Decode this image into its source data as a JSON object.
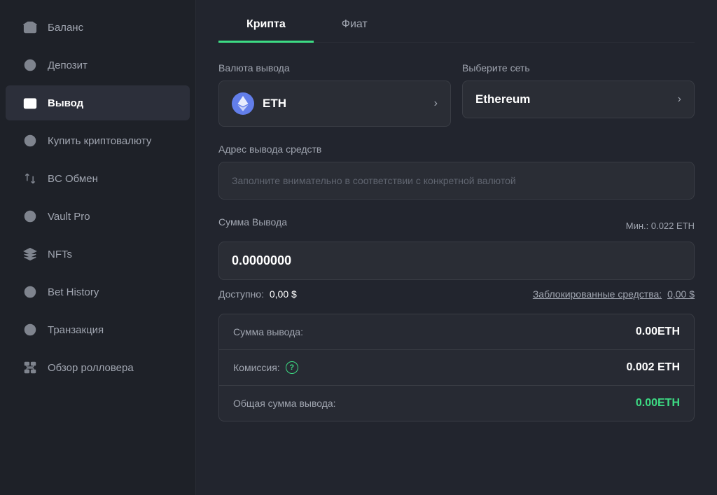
{
  "sidebar": {
    "items": [
      {
        "id": "balance",
        "label": "Баланс",
        "icon": "wallet"
      },
      {
        "id": "deposit",
        "label": "Депозит",
        "icon": "deposit"
      },
      {
        "id": "withdrawal",
        "label": "Вывод",
        "icon": "withdrawal",
        "active": true
      },
      {
        "id": "buy-crypto",
        "label": "Купить криптовалюту",
        "icon": "buy-crypto"
      },
      {
        "id": "bc-exchange",
        "label": "BC Обмен",
        "icon": "exchange"
      },
      {
        "id": "vault-pro",
        "label": "Vault Pro",
        "icon": "vault"
      },
      {
        "id": "nfts",
        "label": "NFTs",
        "icon": "nft"
      },
      {
        "id": "bet-history",
        "label": "Bet History",
        "icon": "clock"
      },
      {
        "id": "transaction",
        "label": "Транзакция",
        "icon": "transaction"
      },
      {
        "id": "rollover",
        "label": "Обзор ролловера",
        "icon": "rollover"
      }
    ]
  },
  "main": {
    "tabs": [
      {
        "id": "crypto",
        "label": "Крипта",
        "active": true
      },
      {
        "id": "fiat",
        "label": "Фиат",
        "active": false
      }
    ],
    "currency_label": "Валюта вывода",
    "currency_value": "ETH",
    "network_label": "Выберите сеть",
    "network_value": "Ethereum",
    "address_label": "Адрес вывода средств",
    "address_placeholder": "Заполните внимательно в соответствии с конкретной валютой",
    "amount_label": "Сумма Вывода",
    "amount_min": "Мин.: 0.022 ETH",
    "amount_value": "0.0000000",
    "available_label": "Доступно:",
    "available_value": "0,00 $",
    "blocked_label": "Заблокированные средства:",
    "blocked_value": "0,00 $",
    "summary": {
      "withdrawal_label": "Сумма вывода:",
      "withdrawal_value": "0.00ETH",
      "fee_label": "Комиссия:",
      "fee_value": "0.002 ETH",
      "total_label": "Общая сумма вывода:",
      "total_value": "0.00ETH"
    }
  }
}
